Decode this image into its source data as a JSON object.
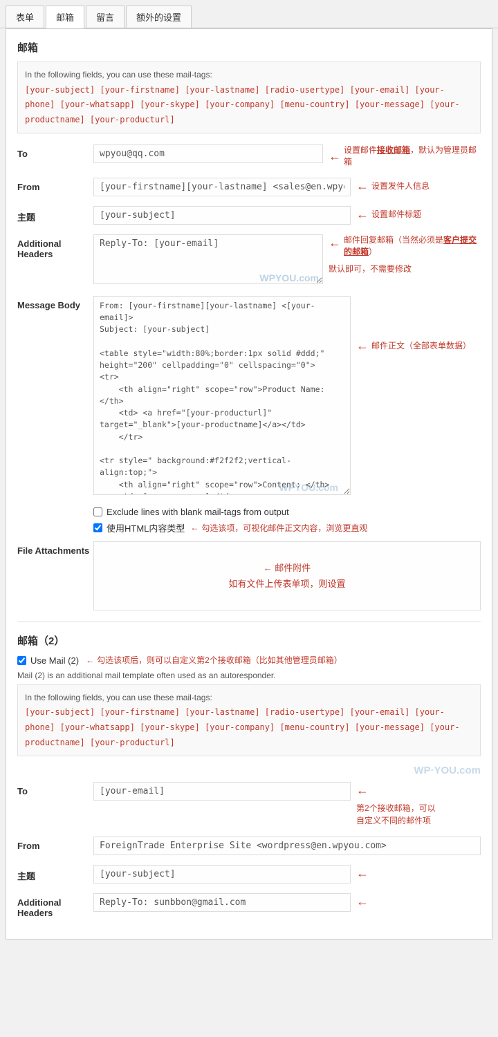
{
  "tabs": [
    {
      "label": "表单",
      "active": false
    },
    {
      "label": "邮箱",
      "active": true
    },
    {
      "label": "留言",
      "active": false
    },
    {
      "label": "额外的设置",
      "active": false
    }
  ],
  "section1": {
    "title": "邮箱",
    "mail_tags_intro": "In the following fields, you can use these mail-tags:",
    "mail_tags": "[your-subject] [your-firstname] [your-lastname] [radio-usertype] [your-email] [your-phone] [your-whatsapp] [your-skype] [your-company] [menu-country] [your-message] [your-productname] [your-producturl]",
    "to_label": "To",
    "to_value": "wpyou@qq.com",
    "to_annotation": "设置邮件接收邮箱，默认为管理员邮箱",
    "to_underline": "接收邮箱",
    "from_label": "From",
    "from_value": "[your-firstname][your-lastname] <sales@en.wpyou.com>",
    "from_annotation": "设置发件人信息",
    "subject_label": "主题",
    "subject_value": "[your-subject]",
    "subject_annotation": "设置邮件标题",
    "additional_headers_label": "Additional Headers",
    "additional_headers_value": "Reply-To: [your-email]",
    "additional_headers_annotation_line1": "邮件回复邮箱（当然必须是客户提交的邮箱）",
    "additional_headers_annotation_line2": "默认即可，不需要修改",
    "additional_headers_underline": "客户提交的邮箱",
    "wpyou_watermark": "WPYOU.com",
    "message_body_label": "Message Body",
    "message_body_value": "From: [your-firstname][your-lastname] <[your-email]>\nSubject: [your-subject]\n\n<table style=\"width:80%;border:1px solid #ddd;\" height=\"200\" cellpadding=\"0\" cellspacing=\"0\">\n<tr>\n    <th align=\"right\" scope=\"row\">Product Name: </th>\n    <td> <a href=\"[your-producturl]\" target=\"_blank\">[your-productname]</a></td>\n    </tr>\n\n<tr style=\" background:#f2f2f2;vertical-align:top;\">\n    <th align=\"right\" scope=\"row\">Content: </th>\n    <td> [your-message]</td>\n</tr>\n</table>\n\n----------------------------------------\nThis e-mail was sent from a contact form on ForeignTrade Enterprise Site (http://en.wpyou.com)",
    "message_body_annotation": "邮件正文（全部表单数据）",
    "checkbox1_label": "Exclude lines with blank mail-tags from output",
    "checkbox1_checked": false,
    "checkbox2_label": "使用HTML内容类型",
    "checkbox2_checked": true,
    "checkbox2_annotation": "勾选该项，可视化邮件正文内容，浏览更直观",
    "file_attachments_label": "File Attachments",
    "file_attachments_annotation1": "邮件附件",
    "file_attachments_annotation2": "如有文件上传表单项，则设置"
  },
  "section2": {
    "title": "邮箱（2）",
    "use_mail_label": "Use Mail (2)",
    "use_mail_checked": true,
    "use_mail_annotation": "勾选该项后，则可以自定义第2个接收邮箱（比如其他管理员邮箱）",
    "note": "Mail (2) is an additional mail template often used as an autoresponder.",
    "mail_tags_intro": "In the following fields, you can use these mail-tags:",
    "mail_tags": "[your-subject] [your-firstname] [your-lastname] [radio-usertype] [your-email] [your-phone] [your-whatsapp] [your-skype] [your-company] [menu-country] [your-message] [your-productname] [your-producturl]",
    "wpyou_watermark": "WP·YOU.com",
    "to_label": "To",
    "to_value": "[your-email]",
    "to_annotation2_line1": "第2个接收邮箱，可以",
    "to_annotation2_line2": "自定义不同的邮件项",
    "from_label": "From",
    "from_value": "ForeignTrade Enterprise Site <wordpress@en.wpyou.com>",
    "subject_label": "主题",
    "subject_value": "[your-subject]",
    "additional_headers_label": "Additional Headers",
    "additional_headers_value": "Reply-To: sunbbon@gmail.com"
  }
}
